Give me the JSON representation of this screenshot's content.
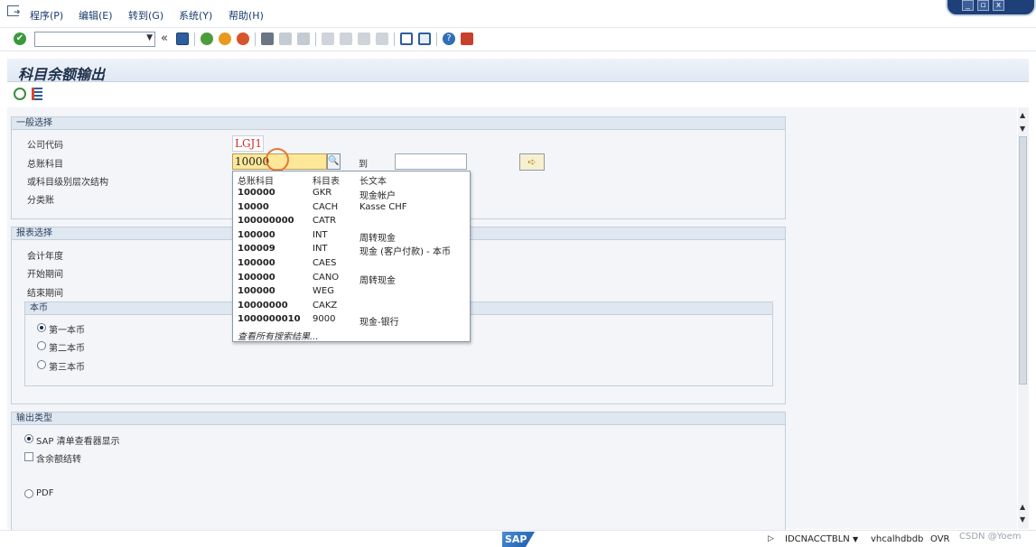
{
  "menu": {
    "items": [
      "程序(P)",
      "编辑(E)",
      "转到(G)",
      "系统(Y)",
      "帮助(H)"
    ]
  },
  "toolbar": {
    "command_field_value": "",
    "double_arrow": "«"
  },
  "page": {
    "title": "科目余额输出"
  },
  "general_selection": {
    "header": "一般选择",
    "company_code_label": "公司代码",
    "company_code_value": "LGJ1",
    "gl_account_label": "总账科目",
    "gl_account_value": "10000",
    "to_label": "到",
    "hierarchy_label": "或科目级别层次结构",
    "ledger_label": "分类账"
  },
  "report_selection": {
    "header": "报表选择",
    "fiscal_year_label": "会计年度",
    "start_period_label": "开始期间",
    "end_period_label": "结束期间",
    "currency_group": {
      "header": "本币",
      "options": [
        "第一本币",
        "第二本币",
        "第三本币"
      ],
      "selected_index": 0
    }
  },
  "output_type": {
    "header": "输出类型",
    "sap_list_viewer_label": "SAP 清单查看器显示",
    "carry_forward_label": "含余额结转",
    "pdf_label": "PDF"
  },
  "dropdown": {
    "headers": [
      "总账科目",
      "科目表",
      "长文本"
    ],
    "rows": [
      [
        "100000",
        "GKR",
        "现金帐户"
      ],
      [
        "10000",
        "CACH",
        "Kasse CHF"
      ],
      [
        "100000000",
        "CATR",
        ""
      ],
      [
        "100000",
        "INT",
        "周转现金"
      ],
      [
        "100009",
        "INT",
        "现金 (客户付款) - 本币"
      ],
      [
        "100000",
        "CAES",
        ""
      ],
      [
        "100000",
        "CANO",
        "周转现金"
      ],
      [
        "100000",
        "WEG",
        ""
      ],
      [
        "10000000",
        "CAKZ",
        ""
      ],
      [
        "1000000010",
        "9000",
        "现金-银行"
      ]
    ],
    "footer": "查看所有搜索结果..."
  },
  "status": {
    "logo": "SAP",
    "system": "IDCNACCTBLN",
    "server": "vhcalhdbdb",
    "mode": "OVR",
    "watermark": "CSDN @Yoem"
  },
  "colors": {
    "brand_blue": "#1e3f78",
    "highlight_field": "#fde89a",
    "focus_circle": "#e8772e",
    "required_text": "#d22b2b"
  }
}
